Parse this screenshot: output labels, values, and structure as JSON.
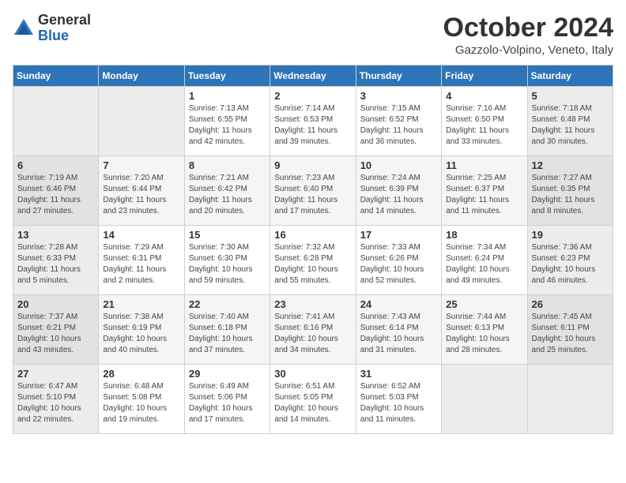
{
  "header": {
    "logo_general": "General",
    "logo_blue": "Blue",
    "month_title": "October 2024",
    "location": "Gazzolo-Volpino, Veneto, Italy"
  },
  "days_of_week": [
    "Sunday",
    "Monday",
    "Tuesday",
    "Wednesday",
    "Thursday",
    "Friday",
    "Saturday"
  ],
  "weeks": [
    [
      {
        "day": "",
        "info": ""
      },
      {
        "day": "",
        "info": ""
      },
      {
        "day": "1",
        "info": "Sunrise: 7:13 AM\nSunset: 6:55 PM\nDaylight: 11 hours and 42 minutes."
      },
      {
        "day": "2",
        "info": "Sunrise: 7:14 AM\nSunset: 6:53 PM\nDaylight: 11 hours and 39 minutes."
      },
      {
        "day": "3",
        "info": "Sunrise: 7:15 AM\nSunset: 6:52 PM\nDaylight: 11 hours and 36 minutes."
      },
      {
        "day": "4",
        "info": "Sunrise: 7:16 AM\nSunset: 6:50 PM\nDaylight: 11 hours and 33 minutes."
      },
      {
        "day": "5",
        "info": "Sunrise: 7:18 AM\nSunset: 6:48 PM\nDaylight: 11 hours and 30 minutes."
      }
    ],
    [
      {
        "day": "6",
        "info": "Sunrise: 7:19 AM\nSunset: 6:46 PM\nDaylight: 11 hours and 27 minutes."
      },
      {
        "day": "7",
        "info": "Sunrise: 7:20 AM\nSunset: 6:44 PM\nDaylight: 11 hours and 23 minutes."
      },
      {
        "day": "8",
        "info": "Sunrise: 7:21 AM\nSunset: 6:42 PM\nDaylight: 11 hours and 20 minutes."
      },
      {
        "day": "9",
        "info": "Sunrise: 7:23 AM\nSunset: 6:40 PM\nDaylight: 11 hours and 17 minutes."
      },
      {
        "day": "10",
        "info": "Sunrise: 7:24 AM\nSunset: 6:39 PM\nDaylight: 11 hours and 14 minutes."
      },
      {
        "day": "11",
        "info": "Sunrise: 7:25 AM\nSunset: 6:37 PM\nDaylight: 11 hours and 11 minutes."
      },
      {
        "day": "12",
        "info": "Sunrise: 7:27 AM\nSunset: 6:35 PM\nDaylight: 11 hours and 8 minutes."
      }
    ],
    [
      {
        "day": "13",
        "info": "Sunrise: 7:28 AM\nSunset: 6:33 PM\nDaylight: 11 hours and 5 minutes."
      },
      {
        "day": "14",
        "info": "Sunrise: 7:29 AM\nSunset: 6:31 PM\nDaylight: 11 hours and 2 minutes."
      },
      {
        "day": "15",
        "info": "Sunrise: 7:30 AM\nSunset: 6:30 PM\nDaylight: 10 hours and 59 minutes."
      },
      {
        "day": "16",
        "info": "Sunrise: 7:32 AM\nSunset: 6:28 PM\nDaylight: 10 hours and 55 minutes."
      },
      {
        "day": "17",
        "info": "Sunrise: 7:33 AM\nSunset: 6:26 PM\nDaylight: 10 hours and 52 minutes."
      },
      {
        "day": "18",
        "info": "Sunrise: 7:34 AM\nSunset: 6:24 PM\nDaylight: 10 hours and 49 minutes."
      },
      {
        "day": "19",
        "info": "Sunrise: 7:36 AM\nSunset: 6:23 PM\nDaylight: 10 hours and 46 minutes."
      }
    ],
    [
      {
        "day": "20",
        "info": "Sunrise: 7:37 AM\nSunset: 6:21 PM\nDaylight: 10 hours and 43 minutes."
      },
      {
        "day": "21",
        "info": "Sunrise: 7:38 AM\nSunset: 6:19 PM\nDaylight: 10 hours and 40 minutes."
      },
      {
        "day": "22",
        "info": "Sunrise: 7:40 AM\nSunset: 6:18 PM\nDaylight: 10 hours and 37 minutes."
      },
      {
        "day": "23",
        "info": "Sunrise: 7:41 AM\nSunset: 6:16 PM\nDaylight: 10 hours and 34 minutes."
      },
      {
        "day": "24",
        "info": "Sunrise: 7:43 AM\nSunset: 6:14 PM\nDaylight: 10 hours and 31 minutes."
      },
      {
        "day": "25",
        "info": "Sunrise: 7:44 AM\nSunset: 6:13 PM\nDaylight: 10 hours and 28 minutes."
      },
      {
        "day": "26",
        "info": "Sunrise: 7:45 AM\nSunset: 6:11 PM\nDaylight: 10 hours and 25 minutes."
      }
    ],
    [
      {
        "day": "27",
        "info": "Sunrise: 6:47 AM\nSunset: 5:10 PM\nDaylight: 10 hours and 22 minutes."
      },
      {
        "day": "28",
        "info": "Sunrise: 6:48 AM\nSunset: 5:08 PM\nDaylight: 10 hours and 19 minutes."
      },
      {
        "day": "29",
        "info": "Sunrise: 6:49 AM\nSunset: 5:06 PM\nDaylight: 10 hours and 17 minutes."
      },
      {
        "day": "30",
        "info": "Sunrise: 6:51 AM\nSunset: 5:05 PM\nDaylight: 10 hours and 14 minutes."
      },
      {
        "day": "31",
        "info": "Sunrise: 6:52 AM\nSunset: 5:03 PM\nDaylight: 10 hours and 11 minutes."
      },
      {
        "day": "",
        "info": ""
      },
      {
        "day": "",
        "info": ""
      }
    ]
  ]
}
